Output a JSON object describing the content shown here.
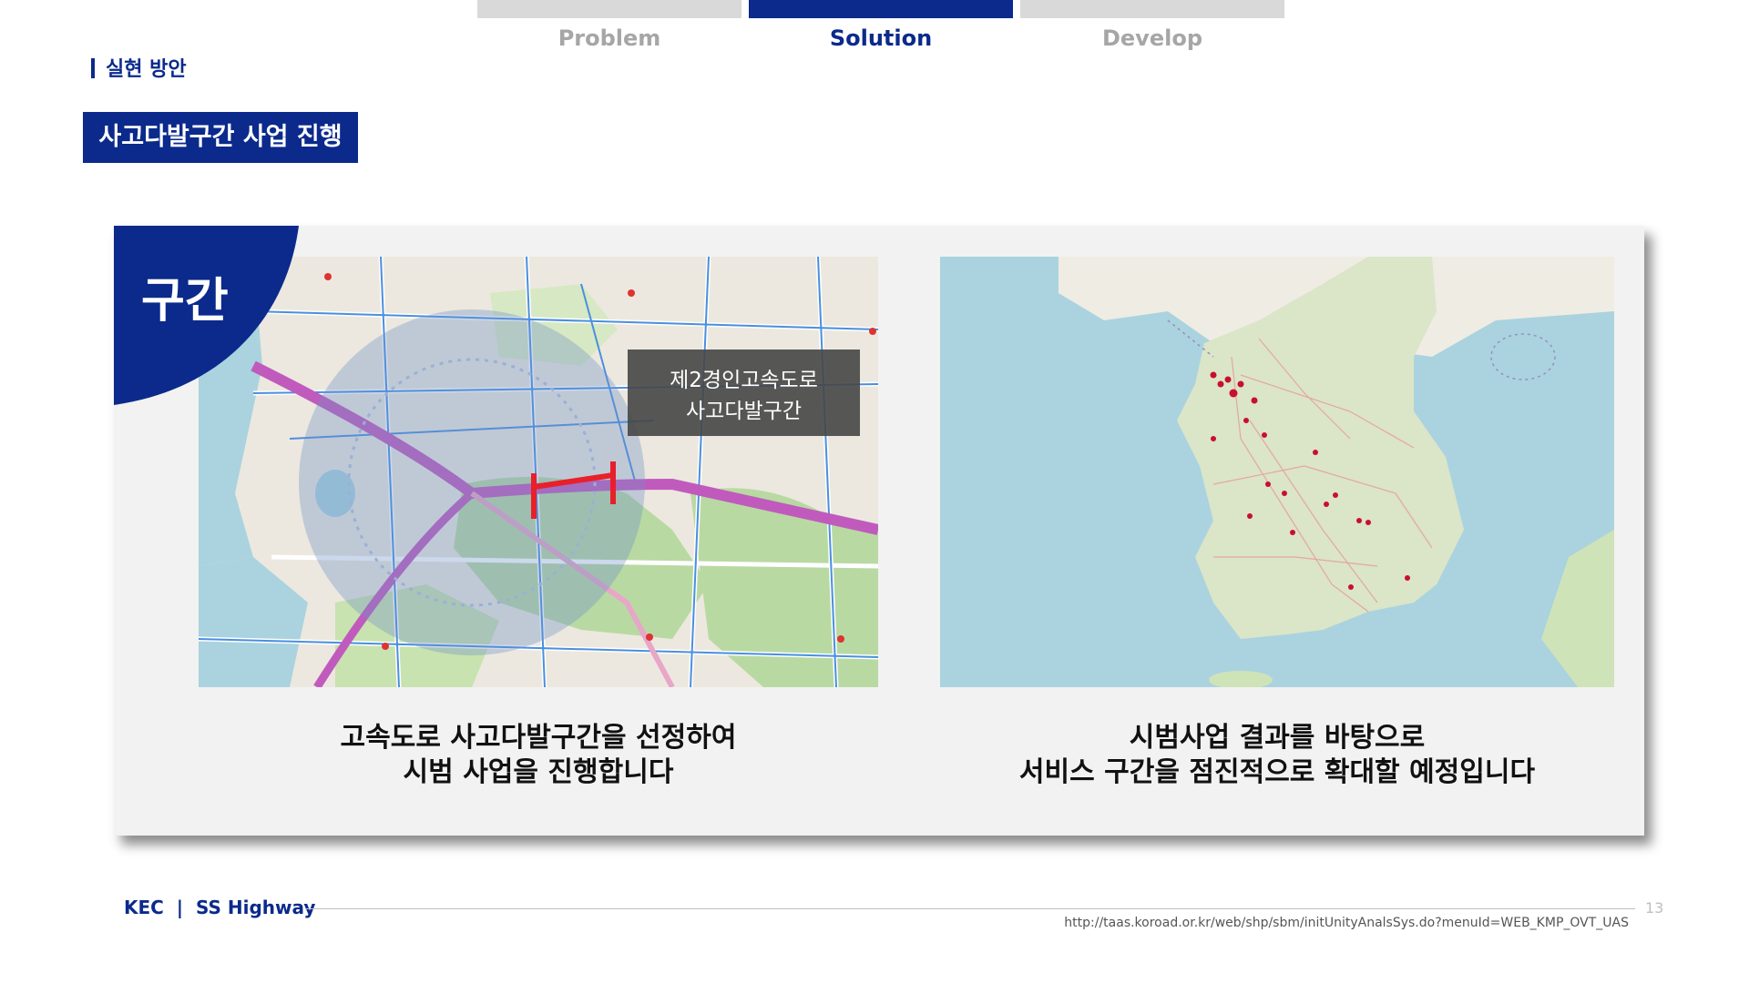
{
  "tabs": [
    {
      "label": "Problem",
      "active": false
    },
    {
      "label": "Solution",
      "active": true
    },
    {
      "label": "Develop",
      "active": false
    }
  ],
  "section_label": "실현 방안",
  "title": "사고다발구간 사업 진행",
  "corner_label": "구간",
  "map_left": {
    "tag_line1": "제2경인고속도로",
    "tag_line2": "사고다발구간",
    "highlight_color": "#e8202a"
  },
  "captions": {
    "left_line1": "고속도로 사고다발구간을 선정하여",
    "left_line2": "시범 사업을 진행합니다",
    "right_line1": "시범사업 결과를 바탕으로",
    "right_line2": "서비스 구간을 점진적으로 확대할 예정입니다"
  },
  "footer": {
    "brand": "KEC  |  SS Highway",
    "url": "http://taas.koroad.or.kr/web/shp/sbm/initUnityAnalsSys.do?menuId=WEB_KMP_OVT_UAS",
    "page": "13"
  },
  "colors": {
    "brand_navy": "#0b2a8c",
    "tab_inactive": "#d9d9d9",
    "panel_bg": "#f2f2f2",
    "accident_marker": "#c8102e"
  }
}
